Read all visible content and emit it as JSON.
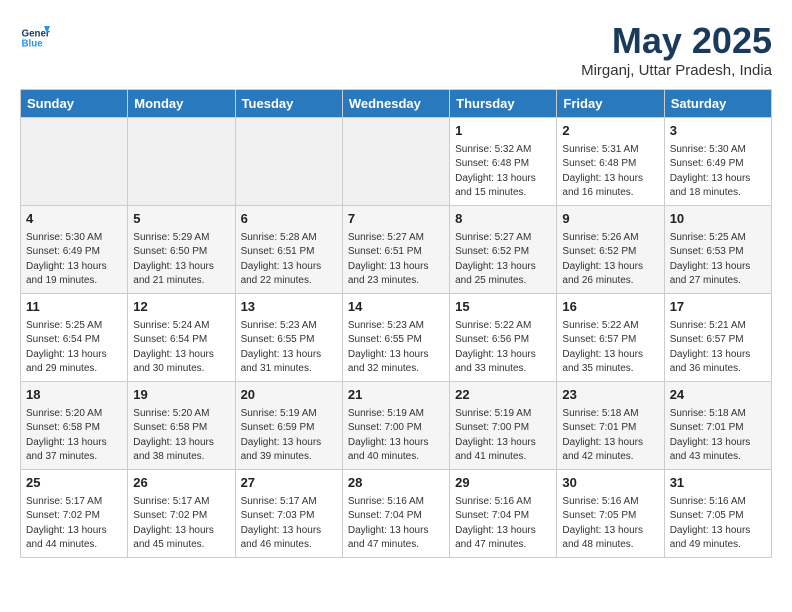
{
  "header": {
    "logo_line1": "General",
    "logo_line2": "Blue",
    "month": "May 2025",
    "location": "Mirganj, Uttar Pradesh, India"
  },
  "weekdays": [
    "Sunday",
    "Monday",
    "Tuesday",
    "Wednesday",
    "Thursday",
    "Friday",
    "Saturday"
  ],
  "weeks": [
    [
      {
        "num": "",
        "info": "",
        "empty": true
      },
      {
        "num": "",
        "info": "",
        "empty": true
      },
      {
        "num": "",
        "info": "",
        "empty": true
      },
      {
        "num": "",
        "info": "",
        "empty": true
      },
      {
        "num": "1",
        "info": "Sunrise: 5:32 AM\nSunset: 6:48 PM\nDaylight: 13 hours\nand 15 minutes."
      },
      {
        "num": "2",
        "info": "Sunrise: 5:31 AM\nSunset: 6:48 PM\nDaylight: 13 hours\nand 16 minutes."
      },
      {
        "num": "3",
        "info": "Sunrise: 5:30 AM\nSunset: 6:49 PM\nDaylight: 13 hours\nand 18 minutes."
      }
    ],
    [
      {
        "num": "4",
        "info": "Sunrise: 5:30 AM\nSunset: 6:49 PM\nDaylight: 13 hours\nand 19 minutes."
      },
      {
        "num": "5",
        "info": "Sunrise: 5:29 AM\nSunset: 6:50 PM\nDaylight: 13 hours\nand 21 minutes."
      },
      {
        "num": "6",
        "info": "Sunrise: 5:28 AM\nSunset: 6:51 PM\nDaylight: 13 hours\nand 22 minutes."
      },
      {
        "num": "7",
        "info": "Sunrise: 5:27 AM\nSunset: 6:51 PM\nDaylight: 13 hours\nand 23 minutes."
      },
      {
        "num": "8",
        "info": "Sunrise: 5:27 AM\nSunset: 6:52 PM\nDaylight: 13 hours\nand 25 minutes."
      },
      {
        "num": "9",
        "info": "Sunrise: 5:26 AM\nSunset: 6:52 PM\nDaylight: 13 hours\nand 26 minutes."
      },
      {
        "num": "10",
        "info": "Sunrise: 5:25 AM\nSunset: 6:53 PM\nDaylight: 13 hours\nand 27 minutes."
      }
    ],
    [
      {
        "num": "11",
        "info": "Sunrise: 5:25 AM\nSunset: 6:54 PM\nDaylight: 13 hours\nand 29 minutes."
      },
      {
        "num": "12",
        "info": "Sunrise: 5:24 AM\nSunset: 6:54 PM\nDaylight: 13 hours\nand 30 minutes."
      },
      {
        "num": "13",
        "info": "Sunrise: 5:23 AM\nSunset: 6:55 PM\nDaylight: 13 hours\nand 31 minutes."
      },
      {
        "num": "14",
        "info": "Sunrise: 5:23 AM\nSunset: 6:55 PM\nDaylight: 13 hours\nand 32 minutes."
      },
      {
        "num": "15",
        "info": "Sunrise: 5:22 AM\nSunset: 6:56 PM\nDaylight: 13 hours\nand 33 minutes."
      },
      {
        "num": "16",
        "info": "Sunrise: 5:22 AM\nSunset: 6:57 PM\nDaylight: 13 hours\nand 35 minutes."
      },
      {
        "num": "17",
        "info": "Sunrise: 5:21 AM\nSunset: 6:57 PM\nDaylight: 13 hours\nand 36 minutes."
      }
    ],
    [
      {
        "num": "18",
        "info": "Sunrise: 5:20 AM\nSunset: 6:58 PM\nDaylight: 13 hours\nand 37 minutes."
      },
      {
        "num": "19",
        "info": "Sunrise: 5:20 AM\nSunset: 6:58 PM\nDaylight: 13 hours\nand 38 minutes."
      },
      {
        "num": "20",
        "info": "Sunrise: 5:19 AM\nSunset: 6:59 PM\nDaylight: 13 hours\nand 39 minutes."
      },
      {
        "num": "21",
        "info": "Sunrise: 5:19 AM\nSunset: 7:00 PM\nDaylight: 13 hours\nand 40 minutes."
      },
      {
        "num": "22",
        "info": "Sunrise: 5:19 AM\nSunset: 7:00 PM\nDaylight: 13 hours\nand 41 minutes."
      },
      {
        "num": "23",
        "info": "Sunrise: 5:18 AM\nSunset: 7:01 PM\nDaylight: 13 hours\nand 42 minutes."
      },
      {
        "num": "24",
        "info": "Sunrise: 5:18 AM\nSunset: 7:01 PM\nDaylight: 13 hours\nand 43 minutes."
      }
    ],
    [
      {
        "num": "25",
        "info": "Sunrise: 5:17 AM\nSunset: 7:02 PM\nDaylight: 13 hours\nand 44 minutes."
      },
      {
        "num": "26",
        "info": "Sunrise: 5:17 AM\nSunset: 7:02 PM\nDaylight: 13 hours\nand 45 minutes."
      },
      {
        "num": "27",
        "info": "Sunrise: 5:17 AM\nSunset: 7:03 PM\nDaylight: 13 hours\nand 46 minutes."
      },
      {
        "num": "28",
        "info": "Sunrise: 5:16 AM\nSunset: 7:04 PM\nDaylight: 13 hours\nand 47 minutes."
      },
      {
        "num": "29",
        "info": "Sunrise: 5:16 AM\nSunset: 7:04 PM\nDaylight: 13 hours\nand 47 minutes."
      },
      {
        "num": "30",
        "info": "Sunrise: 5:16 AM\nSunset: 7:05 PM\nDaylight: 13 hours\nand 48 minutes."
      },
      {
        "num": "31",
        "info": "Sunrise: 5:16 AM\nSunset: 7:05 PM\nDaylight: 13 hours\nand 49 minutes."
      }
    ]
  ]
}
